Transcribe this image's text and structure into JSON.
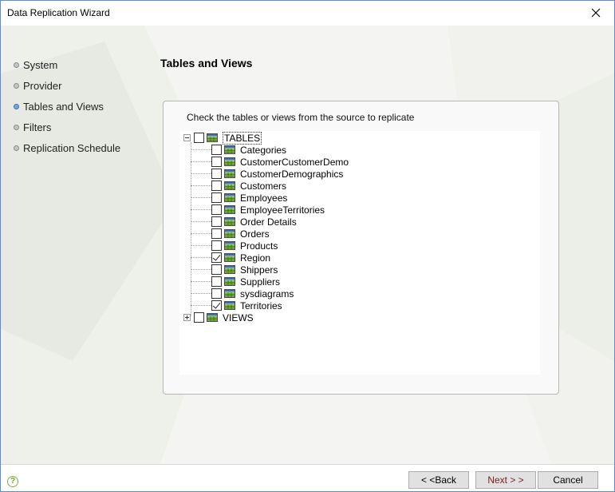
{
  "window": {
    "title": "Data Replication Wizard"
  },
  "nav": {
    "items": [
      {
        "label": "System",
        "active": false
      },
      {
        "label": "Provider",
        "active": false
      },
      {
        "label": "Tables and Views",
        "active": true
      },
      {
        "label": "Filters",
        "active": false
      },
      {
        "label": "Replication Schedule",
        "active": false
      }
    ]
  },
  "page": {
    "heading": "Tables and Views",
    "instructions": "Check the tables or views from the source to replicate"
  },
  "tree": {
    "tables_label": "TABLES",
    "tables_checked": false,
    "tables": [
      {
        "name": "Categories",
        "checked": false
      },
      {
        "name": "CustomerCustomerDemo",
        "checked": false
      },
      {
        "name": "CustomerDemographics",
        "checked": false
      },
      {
        "name": "Customers",
        "checked": false
      },
      {
        "name": "Employees",
        "checked": false
      },
      {
        "name": "EmployeeTerritories",
        "checked": false
      },
      {
        "name": "Order Details",
        "checked": false
      },
      {
        "name": "Orders",
        "checked": false
      },
      {
        "name": "Products",
        "checked": false
      },
      {
        "name": "Region",
        "checked": true
      },
      {
        "name": "Shippers",
        "checked": false
      },
      {
        "name": "Suppliers",
        "checked": false
      },
      {
        "name": "sysdiagrams",
        "checked": false
      },
      {
        "name": "Territories",
        "checked": true
      }
    ],
    "views_label": "VIEWS",
    "views_checked": false
  },
  "footer": {
    "back_label": "< <Back",
    "next_label": "Next > >",
    "cancel_label": "Cancel",
    "help_glyph": "?"
  },
  "colors": {
    "accent": "#5a8fcf",
    "next_text": "#7a1b1b",
    "table_icon_header": "#3f6ea8",
    "table_icon_grid": "#7fbf3f"
  }
}
